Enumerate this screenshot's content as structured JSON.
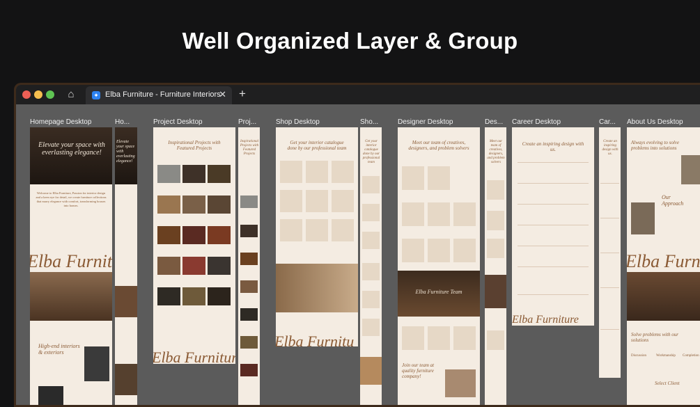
{
  "hero": {
    "title": "Well Organized Layer & Group"
  },
  "browser": {
    "tab_title": "Elba Furniture - Furniture Interiors",
    "tab_close": "✕",
    "new_tab": "+",
    "home_icon": "⌂",
    "favicon": "✦"
  },
  "frames": [
    {
      "label": "Homepage Desktop"
    },
    {
      "label": "Ho..."
    },
    {
      "label": "Project Desktop"
    },
    {
      "label": "Proj..."
    },
    {
      "label": "Shop Desktop"
    },
    {
      "label": "Sho..."
    },
    {
      "label": "Designer Desktop"
    },
    {
      "label": "Des..."
    },
    {
      "label": "Career Desktop"
    },
    {
      "label": "Car..."
    },
    {
      "label": "About Us Desktop"
    }
  ],
  "content": {
    "home_hero": "Elevate your space with everlasting elegance!",
    "home_mobile_hero": "Elevate your space with everlasting elegance!",
    "home_welcome": "Welcome to Elba Furniture, Passion for interior design and a keen eye for detail, we create furniture collections that marry elegance with comfort, transforming houses into homes.",
    "home_brand": "Elba Furnitu",
    "home_highend": "High-end interiors & exteriors",
    "project_heading": "Inspirational Projects with Featured Projects",
    "project_mobile_heading": "Inspirational Projects with Featured Projects",
    "project_brand": "Elba Furnitur",
    "shop_heading": "Get your interior catalogue done by our professional team",
    "shop_mobile_heading": "Get your interior catalogue done by our professional team",
    "shop_brand": "Elba Furnitu",
    "designer_heading": "Meet our team of creatives, designers, and problem solvers",
    "designer_mobile_heading": "Meet our team of creatives, designers, and problem solvers",
    "designer_banner": "Elba Furniture Team",
    "designer_join": "Join our team at quality furniture company!",
    "career_heading": "Create an inspiring design with us.",
    "career_mobile_heading": "Create an inspiring design with us.",
    "career_brand": "Elba Furniture",
    "about_heading": "Always evolving to solve problems into solutions",
    "about_approach": "Our Approach",
    "about_brand": "Elba Furnit",
    "about_solve": "Solve problems with our solutions",
    "about_client": "Select Client",
    "about_cols": [
      "Discussion",
      "Workmanship",
      "Completion"
    ]
  }
}
